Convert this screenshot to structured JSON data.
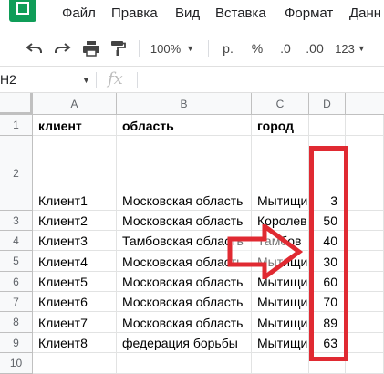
{
  "menu": {
    "items": [
      "Файл",
      "Правка",
      "Вид",
      "Вставка",
      "Формат",
      "Данн"
    ]
  },
  "toolbar": {
    "zoom": "100%",
    "currency": "р.",
    "percent": "%",
    "decrease_decimal": ".0",
    "increase_decimal": ".00",
    "more_formats": "123"
  },
  "formula_bar": {
    "cell_ref": "H2",
    "fx": "fx",
    "content": ""
  },
  "columns": [
    "A",
    "B",
    "C",
    "D"
  ],
  "row_numbers": [
    "1",
    "2",
    "3",
    "4",
    "5",
    "6",
    "7",
    "8",
    "9",
    "10"
  ],
  "header": {
    "client": "клиент",
    "region": "область",
    "city": "город",
    "value": ""
  },
  "rows": [
    {
      "client": "Клиент1",
      "region": "Московская область",
      "city": "Мытищи",
      "value": "3"
    },
    {
      "client": "Клиент2",
      "region": "Московская область",
      "city": "Королев",
      "value": "50"
    },
    {
      "client": "Клиент3",
      "region": "Тамбовская область",
      "city": "Тамбов",
      "value": "40"
    },
    {
      "client": "Клиент4",
      "region": "Московская область",
      "city": "Мытищи",
      "value": "30"
    },
    {
      "client": "Клиент5",
      "region": "Московская область",
      "city": "Мытищи",
      "value": "60"
    },
    {
      "client": "Клиент6",
      "region": "Московская область",
      "city": "Мытищи",
      "value": "70"
    },
    {
      "client": "Клиент7",
      "region": "Московская область",
      "city": "Мытищи",
      "value": "89"
    },
    {
      "client": "Клиент8",
      "region": "федерация борьбы",
      "city": "Мытищи",
      "value": "63"
    }
  ],
  "colors": {
    "highlight": "#e02a32",
    "sheets_green": "#0f9d58"
  }
}
